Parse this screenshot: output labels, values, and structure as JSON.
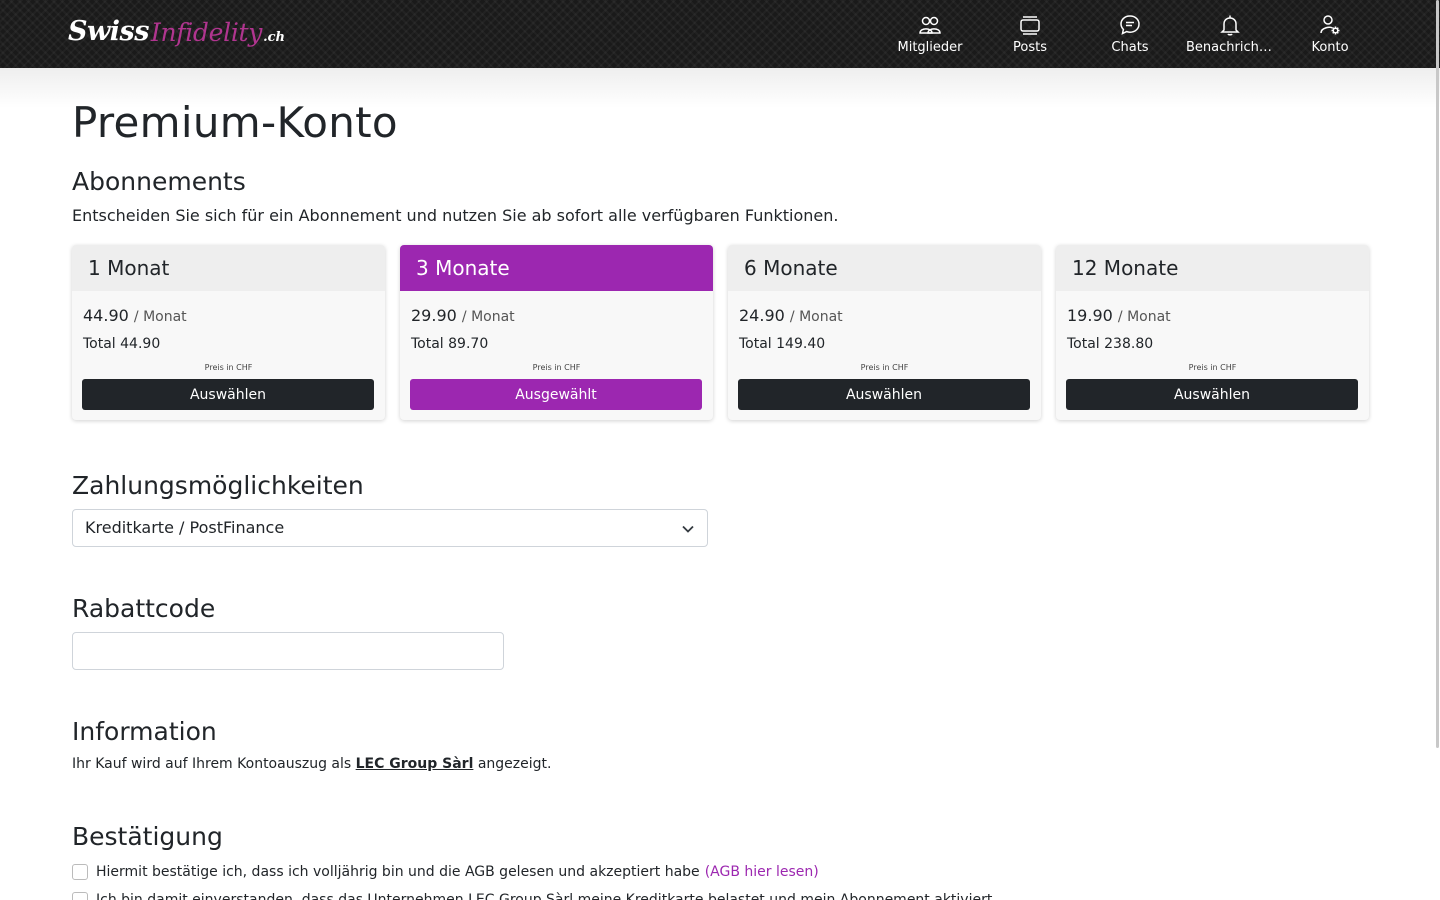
{
  "header": {
    "logo": {
      "part1": "Swiss",
      "part2": "Infidelity",
      "part3": ".ch"
    },
    "nav": [
      {
        "label": "Mitglieder",
        "icon": "members-icon"
      },
      {
        "label": "Posts",
        "icon": "posts-icon"
      },
      {
        "label": "Chats",
        "icon": "chat-icon"
      },
      {
        "label": "Benachrichtigungen",
        "icon": "bell-icon"
      },
      {
        "label": "Konto",
        "icon": "account-settings-icon"
      }
    ]
  },
  "page": {
    "title": "Premium-Konto",
    "subscriptions": {
      "heading": "Abonnements",
      "lead": "Entscheiden Sie sich für ein Abonnement und nutzen Sie ab sofort alle verfügbaren Funktionen.",
      "plans": [
        {
          "name": "1 Monat",
          "price": "44.90",
          "per": "/ Monat",
          "total": "Total 44.90",
          "note": "Preis in CHF",
          "button": "Auswählen",
          "selected": false
        },
        {
          "name": "3 Monate",
          "price": "29.90",
          "per": "/ Monat",
          "total": "Total 89.70",
          "note": "Preis in CHF",
          "button": "Ausgewählt",
          "selected": true
        },
        {
          "name": "6 Monate",
          "price": "24.90",
          "per": "/ Monat",
          "total": "Total 149.40",
          "note": "Preis in CHF",
          "button": "Auswählen",
          "selected": false
        },
        {
          "name": "12 Monate",
          "price": "19.90",
          "per": "/ Monat",
          "total": "Total 238.80",
          "note": "Preis in CHF",
          "button": "Auswählen",
          "selected": false
        }
      ]
    },
    "payment": {
      "heading": "Zahlungsmöglichkeiten",
      "selected": "Kreditkarte / PostFinance"
    },
    "discount": {
      "heading": "Rabattcode",
      "value": "",
      "placeholder": ""
    },
    "information": {
      "heading": "Information",
      "text_before": "Ihr Kauf wird auf Ihrem Kontoauszug als",
      "company": "LEC Group Sàrl",
      "text_after": "angezeigt."
    },
    "confirmation": {
      "heading": "Bestätigung",
      "items": [
        {
          "text": "Hiermit bestätige ich, dass ich volljährig bin und die AGB gelesen und akzeptiert habe",
          "link": "(AGB hier lesen)"
        },
        {
          "text": "Ich bin damit einverstanden, dass das Unternehmen LEC Group Sàrl meine Kreditkarte belastet und mein Abonnement aktiviert."
        }
      ]
    }
  },
  "colors": {
    "accent": "#9c27b0",
    "dark": "#212529",
    "header_bg": "#1a1a1a"
  }
}
